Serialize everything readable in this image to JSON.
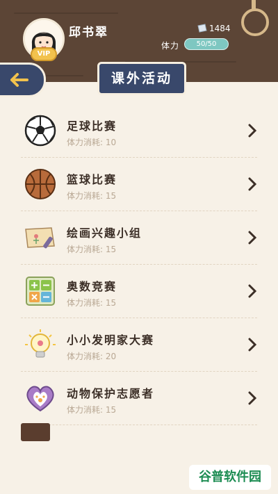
{
  "header": {
    "username": "邱书翠",
    "vip_label": "VIP",
    "gem_count": "1484",
    "stamina_label": "体力",
    "stamina_value": "50/50"
  },
  "page": {
    "title": "课外活动"
  },
  "activities": [
    {
      "name": "足球比赛",
      "cost": "体力消耗: 10",
      "icon": "soccer-ball-icon"
    },
    {
      "name": "篮球比赛",
      "cost": "体力消耗: 15",
      "icon": "basketball-icon"
    },
    {
      "name": "绘画兴趣小组",
      "cost": "体力消耗: 15",
      "icon": "painting-icon"
    },
    {
      "name": "奥数竞赛",
      "cost": "体力消耗: 15",
      "icon": "math-operators-icon"
    },
    {
      "name": "小小发明家大赛",
      "cost": "体力消耗: 20",
      "icon": "lightbulb-icon"
    },
    {
      "name": "动物保护志愿者",
      "cost": "体力消耗: 15",
      "icon": "paw-heart-icon"
    }
  ],
  "watermark": "谷普软件园",
  "colors": {
    "header_bg": "#5c4536",
    "banner_bg": "#39486b",
    "page_bg": "#f7f1e7",
    "stamina": "#7ec7c1"
  }
}
